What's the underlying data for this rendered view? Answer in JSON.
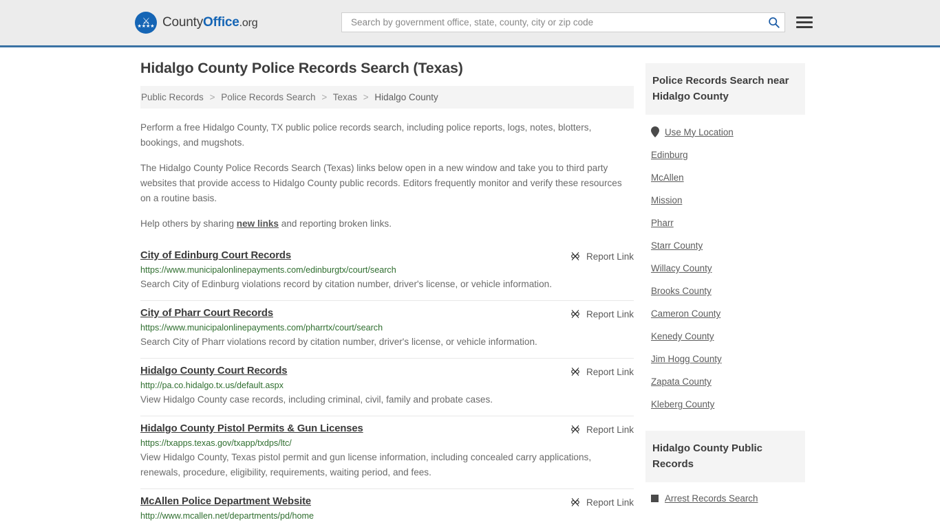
{
  "header": {
    "logo": {
      "part1": "County",
      "part2": "Office",
      "part3": ".org"
    },
    "search": {
      "placeholder": "Search by government office, state, county, city or zip code",
      "value": ""
    },
    "search_icon_name": "search-icon",
    "menu_icon_name": "hamburger-menu-icon"
  },
  "page": {
    "title": "Hidalgo County Police Records Search (Texas)",
    "breadcrumb": [
      "Public Records",
      "Police Records Search",
      "Texas",
      "Hidalgo County"
    ],
    "breadcrumb_separator": ">",
    "intro": [
      "Perform a free Hidalgo County, TX public police records search, including police reports, logs, notes, blotters, bookings, and mugshots.",
      "The Hidalgo County Police Records Search (Texas) links below open in a new window and take you to third party websites that provide access to Hidalgo County public records. Editors frequently monitor and verify these resources on a routine basis.",
      "Help others by sharing new links and reporting broken links."
    ],
    "help_prefix": "Help others by sharing ",
    "help_link": "new links",
    "help_suffix": " and reporting broken links."
  },
  "report_link_label": "Report Link",
  "results": [
    {
      "title": "City of Edinburg Court Records",
      "url": "https://www.municipalonlinepayments.com/edinburgtx/court/search",
      "description": "Search City of Edinburg violations record by citation number, driver's license, or vehicle information."
    },
    {
      "title": "City of Pharr Court Records",
      "url": "https://www.municipalonlinepayments.com/pharrtx/court/search",
      "description": "Search City of Pharr violations record by citation number, driver's license, or vehicle information."
    },
    {
      "title": "Hidalgo County Court Records",
      "url": "http://pa.co.hidalgo.tx.us/default.aspx",
      "description": "View Hidalgo County case records, including criminal, civil, family and probate cases."
    },
    {
      "title": "Hidalgo County Pistol Permits & Gun Licenses",
      "url": "https://txapps.texas.gov/txapp/txdps/ltc/",
      "description": "View Hidalgo County, Texas pistol permit and gun license information, including concealed carry applications, renewals, procedure, eligibility, requirements, waiting period, and fees."
    },
    {
      "title": "McAllen Police Department Website",
      "url": "http://www.mcallen.net/departments/pd/home",
      "description": ""
    }
  ],
  "sidebar": {
    "nearby_heading": "Police Records Search near Hidalgo County",
    "use_my_location": "Use My Location",
    "nearby_links": [
      "Edinburg",
      "McAllen",
      "Mission",
      "Pharr",
      "Starr County",
      "Willacy County",
      "Brooks County",
      "Cameron County",
      "Kenedy County",
      "Jim Hogg County",
      "Zapata County",
      "Kleberg County"
    ],
    "public_records_heading": "Hidalgo County Public Records",
    "public_records_items": [
      "Arrest Records Search"
    ]
  },
  "colors": {
    "header_bg": "#ececec",
    "header_border": "#3a72a4",
    "brand_blue": "#1565b5",
    "url_green": "#2f6e2f",
    "panel_gray": "#f4f4f4"
  }
}
